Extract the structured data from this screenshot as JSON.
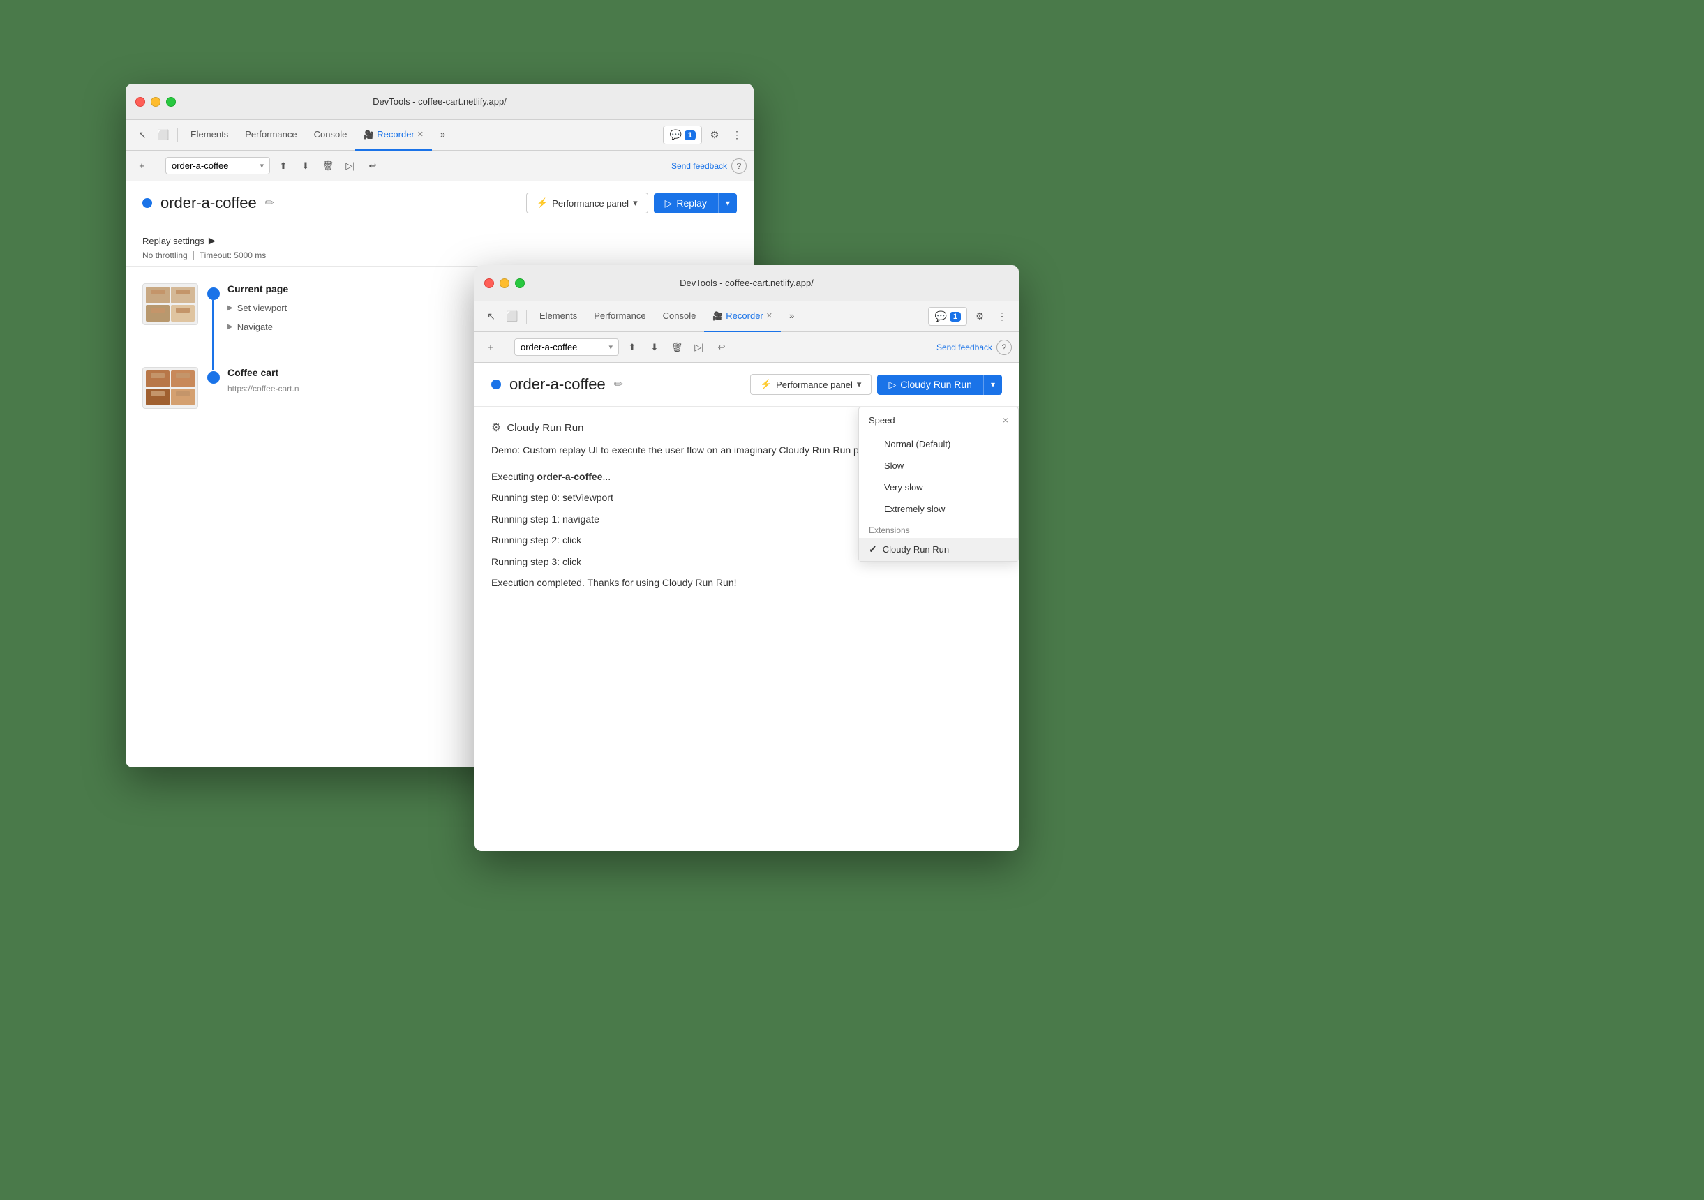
{
  "window_back": {
    "titlebar": {
      "title": "DevTools - coffee-cart.netlify.app/"
    },
    "devtools_tabs": [
      {
        "label": "Elements",
        "active": false
      },
      {
        "label": "Performance",
        "active": false
      },
      {
        "label": "Console",
        "active": false
      },
      {
        "label": "Recorder",
        "active": true,
        "closeable": true
      },
      {
        "label": "»",
        "active": false
      }
    ],
    "badge_count": "1",
    "recorder_toolbar": {
      "plus": "+",
      "recording_name": "order-a-coffee",
      "send_feedback": "Send feedback"
    },
    "recording_title": "order-a-coffee",
    "perf_panel_label": "Performance panel",
    "replay_label": "Replay",
    "replay_settings": {
      "header": "Replay settings",
      "throttling": "No throttling",
      "timeout": "Timeout: 5000 ms"
    },
    "steps": [
      {
        "page_label": "Current page",
        "substeps": [
          "Set viewport",
          "Navigate"
        ]
      },
      {
        "page_label": "Coffee cart",
        "page_url": "https://coffee-cart.n",
        "substeps": []
      }
    ]
  },
  "window_front": {
    "titlebar": {
      "title": "DevTools - coffee-cart.netlify.app/"
    },
    "devtools_tabs": [
      {
        "label": "Elements",
        "active": false
      },
      {
        "label": "Performance",
        "active": false
      },
      {
        "label": "Console",
        "active": false
      },
      {
        "label": "Recorder",
        "active": true,
        "closeable": true
      },
      {
        "label": "»",
        "active": false
      }
    ],
    "badge_count": "1",
    "recorder_toolbar": {
      "plus": "+",
      "recording_name": "order-a-coffee",
      "send_feedback": "Send feedback"
    },
    "recording_title": "order-a-coffee",
    "perf_panel_label": "Performance panel",
    "cloudy_btn_label": "Cloudy Run Run",
    "cloudy_header": "Cloudy Run Run",
    "demo_text": "Demo: Custom replay UI to execute the user flow on an imaginary Cloudy Run Run platform.",
    "execution_lines": [
      {
        "text": "Executing ",
        "bold": "order-a-coffee",
        "suffix": "..."
      },
      {
        "text": "Running step 0: setViewport"
      },
      {
        "text": "Running step 1: navigate"
      },
      {
        "text": "Running step 2: click"
      },
      {
        "text": "Running step 3: click"
      },
      {
        "text": "Execution completed. Thanks for using Cloudy Run Run!"
      }
    ],
    "speed_dropdown": {
      "header": "Speed",
      "close_btn": "×",
      "items": [
        {
          "label": "Normal (Default)",
          "selected": false
        },
        {
          "label": "Slow",
          "selected": false
        },
        {
          "label": "Very slow",
          "selected": false
        },
        {
          "label": "Extremely slow",
          "selected": false
        }
      ],
      "extensions_label": "Extensions",
      "extension_items": [
        {
          "label": "Cloudy Run Run",
          "selected": true
        }
      ]
    }
  }
}
